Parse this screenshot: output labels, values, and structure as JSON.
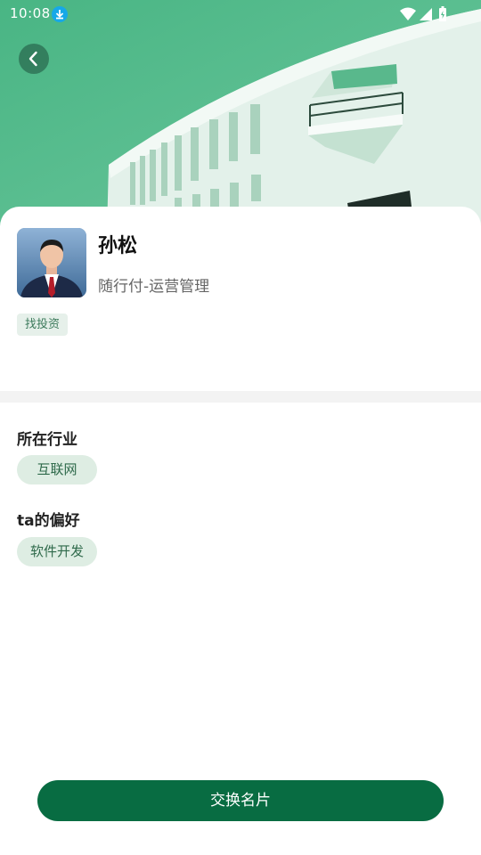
{
  "status_bar": {
    "time": "10:08",
    "download_icon": "download-icon",
    "wifi_icon": "wifi-icon",
    "signal_icon": "signal-icon",
    "battery_icon": "battery-charging-icon"
  },
  "header": {
    "back_icon": "chevron-left-icon",
    "background": "building-photo"
  },
  "profile": {
    "name": "孙松",
    "company_role": "随行付-运营管理",
    "tag": "找投资"
  },
  "industry": {
    "title": "所在行业",
    "value": "互联网"
  },
  "preference": {
    "title": "ta的偏好",
    "value": "软件开发"
  },
  "actions": {
    "exchange_card_label": "交换名片"
  },
  "colors": {
    "header_green": "#4fbb8a",
    "button_green": "#086c42",
    "pill_bg": "#deede3",
    "pill_text": "#2f6a4b"
  }
}
